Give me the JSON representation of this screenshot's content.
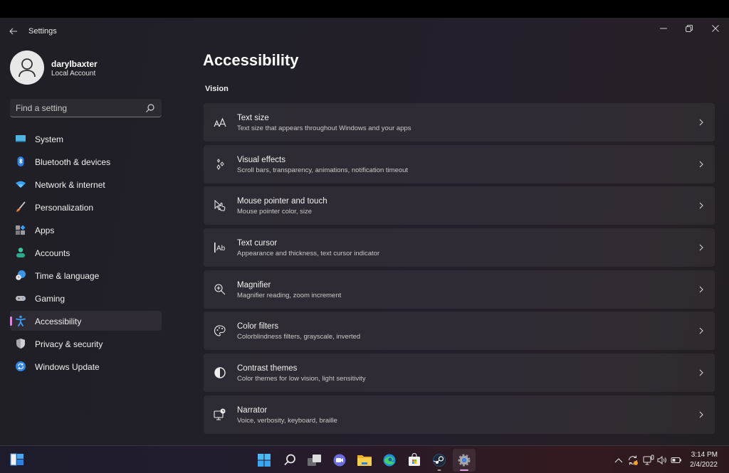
{
  "window": {
    "title": "Settings",
    "controls": {
      "minimize": "minimize",
      "maximize": "restore",
      "close": "close"
    }
  },
  "profile": {
    "name": "darylbaxter",
    "account_type": "Local Account"
  },
  "search": {
    "placeholder": "Find a setting",
    "value": ""
  },
  "sidebar": {
    "items": [
      {
        "label": "System",
        "icon": "monitor-icon",
        "active": false
      },
      {
        "label": "Bluetooth & devices",
        "icon": "bluetooth-icon",
        "active": false
      },
      {
        "label": "Network & internet",
        "icon": "wifi-icon",
        "active": false
      },
      {
        "label": "Personalization",
        "icon": "brush-icon",
        "active": false
      },
      {
        "label": "Apps",
        "icon": "apps-icon",
        "active": false
      },
      {
        "label": "Accounts",
        "icon": "person-icon",
        "active": false
      },
      {
        "label": "Time & language",
        "icon": "globe-clock-icon",
        "active": false
      },
      {
        "label": "Gaming",
        "icon": "gamepad-icon",
        "active": false
      },
      {
        "label": "Accessibility",
        "icon": "accessibility-icon",
        "active": true
      },
      {
        "label": "Privacy & security",
        "icon": "shield-icon",
        "active": false
      },
      {
        "label": "Windows Update",
        "icon": "update-icon",
        "active": false
      }
    ]
  },
  "main": {
    "title": "Accessibility",
    "section": "Vision",
    "cards": [
      {
        "title": "Text size",
        "description": "Text size that appears throughout Windows and your apps",
        "icon": "text-size-icon"
      },
      {
        "title": "Visual effects",
        "description": "Scroll bars, transparency, animations, notification timeout",
        "icon": "sparkle-icon"
      },
      {
        "title": "Mouse pointer and touch",
        "description": "Mouse pointer color, size",
        "icon": "pointer-touch-icon"
      },
      {
        "title": "Text cursor",
        "description": "Appearance and thickness, text cursor indicator",
        "icon": "text-cursor-icon"
      },
      {
        "title": "Magnifier",
        "description": "Magnifier reading, zoom increment",
        "icon": "zoom-in-icon"
      },
      {
        "title": "Color filters",
        "description": "Colorblindness filters, grayscale, inverted",
        "icon": "palette-icon"
      },
      {
        "title": "Contrast themes",
        "description": "Color themes for low vision, light sensitivity",
        "icon": "contrast-icon"
      },
      {
        "title": "Narrator",
        "description": "Voice, verbosity, keyboard, braille",
        "icon": "narrator-icon"
      }
    ]
  },
  "taskbar": {
    "widgets_icon": "widgets-icon",
    "apps": [
      {
        "name": "start",
        "icon": "windows-logo-icon",
        "running": false,
        "active": false
      },
      {
        "name": "search",
        "icon": "search-icon",
        "running": false,
        "active": false
      },
      {
        "name": "task-view",
        "icon": "task-view-icon",
        "running": false,
        "active": false
      },
      {
        "name": "chat",
        "icon": "chat-icon",
        "running": false,
        "active": false
      },
      {
        "name": "file-explorer",
        "icon": "folder-icon",
        "running": false,
        "active": false
      },
      {
        "name": "edge",
        "icon": "edge-icon",
        "running": false,
        "active": false
      },
      {
        "name": "store",
        "icon": "store-icon",
        "running": false,
        "active": false
      },
      {
        "name": "steam",
        "icon": "steam-icon",
        "running": true,
        "active": false
      },
      {
        "name": "settings",
        "icon": "gear-icon",
        "running": true,
        "active": true
      }
    ],
    "tray": {
      "icons": [
        "chevron-up-icon",
        "sync-icon",
        "network-icon",
        "volume-icon",
        "battery-icon"
      ],
      "time": "3:14 PM",
      "date": "2/4/2022"
    }
  },
  "colors": {
    "accent": "#4cc2ff",
    "selection_indicator": "#d48bd8",
    "sync_badge": "#f7a12b"
  }
}
